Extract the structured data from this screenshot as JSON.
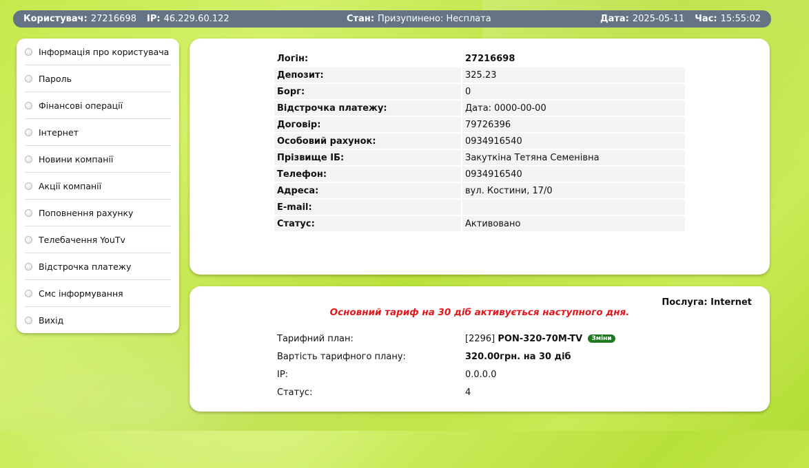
{
  "topbar": {
    "user_label": "Користувач:",
    "user_value": "27216698",
    "ip_label": "IP:",
    "ip_value": "46.229.60.122",
    "state_label": "Стан:",
    "state_value": "Призупинено: Несплата",
    "date_label": "Дата:",
    "date_value": "2025-05-11",
    "time_label": "Час:",
    "time_value": "15:55:02"
  },
  "sidebar": {
    "items": [
      {
        "label": "Інформація про користувача"
      },
      {
        "label": "Пароль"
      },
      {
        "label": "Фінансові операції"
      },
      {
        "label": "Інтернет"
      },
      {
        "label": "Новини компанії"
      },
      {
        "label": "Акції компанії"
      },
      {
        "label": "Поповнення рахунку"
      },
      {
        "label": "Телебачення YouTv"
      },
      {
        "label": "Відстрочка платежу"
      },
      {
        "label": "Смс інформування"
      },
      {
        "label": "Вихід"
      }
    ]
  },
  "user_info": {
    "rows": [
      {
        "key": "Логін:",
        "value": "27216698"
      },
      {
        "key": "Депозит:",
        "value": "325.23"
      },
      {
        "key": "Борг:",
        "value": "0"
      },
      {
        "key": "Відстрочка платежу:",
        "value": "Дата: 0000-00-00"
      },
      {
        "key": "Договір:",
        "value": "79726396"
      },
      {
        "key": "Особовий рахунок:",
        "value": "0934916540"
      },
      {
        "key": "Прізвище ІБ:",
        "value": "Закуткіна Тетяна Семенівна"
      },
      {
        "key": "Телефон:",
        "value": "0934916540"
      },
      {
        "key": "Адреса:",
        "value": "вул. Костини, 17/0"
      },
      {
        "key": "E-mail:",
        "value": ""
      },
      {
        "key": "Статус:",
        "value": "Активовано"
      }
    ]
  },
  "service": {
    "title_label": "Послуга:",
    "title_value": "Internet",
    "warning": "Основний тариф на 30 діб активується наступного дня.",
    "plan_label": "Тарифний план:",
    "plan_code": "[2296]",
    "plan_name": "PON-320-70M-TV",
    "change_label": "Зміни",
    "cost_label": "Вартість тарифного плану:",
    "cost_value": "320.00грн. на 30 діб",
    "ip_label": "IP:",
    "ip_value": "0.0.0.0",
    "status_label": "Статус:",
    "status_value": "4"
  }
}
